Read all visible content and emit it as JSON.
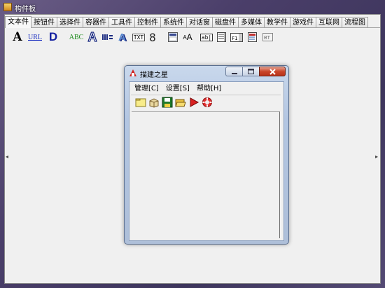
{
  "window": {
    "title": "构件板"
  },
  "tabs": [
    {
      "label": "文本件",
      "active": true
    },
    {
      "label": "按钮件"
    },
    {
      "label": "选择件"
    },
    {
      "label": "容器件"
    },
    {
      "label": "工具件"
    },
    {
      "label": "控制件"
    },
    {
      "label": "系统件"
    },
    {
      "label": "对话窗"
    },
    {
      "label": "磁盘件"
    },
    {
      "label": "多媒体"
    },
    {
      "label": "教学件"
    },
    {
      "label": "游戏件"
    },
    {
      "label": "互联网"
    },
    {
      "label": "流程图"
    }
  ],
  "components": {
    "big_a": "A",
    "url": "URL",
    "bold_d": "D",
    "abc": "ABC",
    "outline_a": "A",
    "digit_8": "8",
    "txt": "TXT",
    "small_aa": "A",
    "abl": "ab|"
  },
  "dialog": {
    "title": "描建之星",
    "menu": [
      "管理[C]",
      "设置[S]",
      "帮助[H]"
    ]
  },
  "scroll_arrows": {
    "left": "◂",
    "right": "▸"
  }
}
